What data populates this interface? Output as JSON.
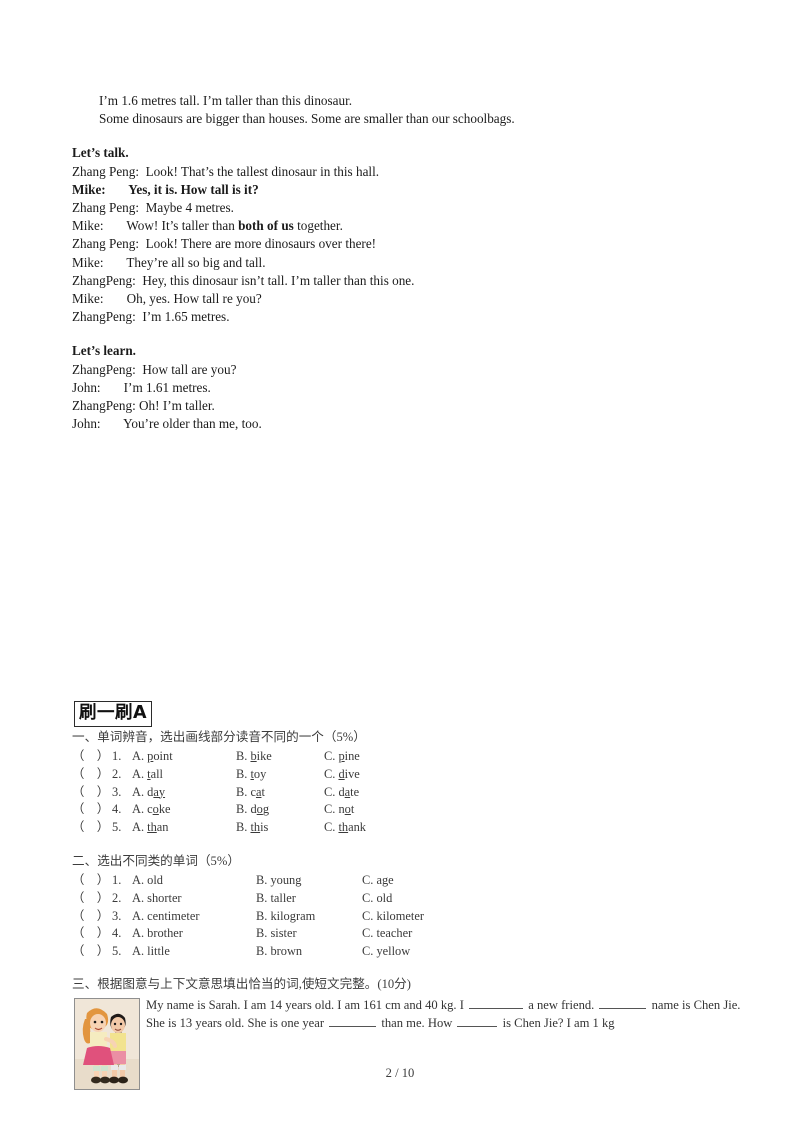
{
  "lesson": {
    "intro_lines": [
      "I’m 1.6 metres tall. I’m taller than this dinosaur.",
      "Some dinosaurs are bigger than houses. Some are smaller than our schoolbags."
    ],
    "talk_heading": "Let’s talk.",
    "talk_lines": [
      {
        "speaker": "Zhang Peng:",
        "text": "  Look! That’s the tallest dinosaur in this hall.",
        "bold": false
      },
      {
        "speaker": "Mike:",
        "text": "       Yes, it is. How tall is it?",
        "bold": true
      },
      {
        "speaker": "Zhang Peng:",
        "text": "  Maybe 4 metres.",
        "bold": false
      },
      {
        "speaker": "Mike:",
        "text": "       Wow! It’s taller than ",
        "bold_fragment": "both of us",
        "text_after": " together.",
        "bold": false
      },
      {
        "speaker": "Zhang Peng:",
        "text": "  Look! There are more dinosaurs over there!",
        "bold": false
      },
      {
        "speaker": "Mike:",
        "text": "       They’re all so big and tall.",
        "bold": false
      },
      {
        "speaker": "ZhangPeng:",
        "text": "  Hey, this dinosaur isn’t tall. I’m taller than this one.",
        "bold": false
      },
      {
        "speaker": "Mike:",
        "text": "       Oh, yes. How tall re you?",
        "bold": false
      },
      {
        "speaker": "ZhangPeng:",
        "text": "  I’m 1.65 metres.",
        "bold": false
      }
    ],
    "learn_heading": "Let’s learn.",
    "learn_lines": [
      {
        "speaker": "ZhangPeng:",
        "text": "  How tall are you?"
      },
      {
        "speaker": "John:",
        "text": "       I’m 1.61 metres."
      },
      {
        "speaker": "ZhangPeng:",
        "text": " Oh! I’m taller."
      },
      {
        "speaker": "John:",
        "text": "       You’re older than me, too."
      }
    ]
  },
  "brush_box": {
    "label": "刷一刷A"
  },
  "section_one": {
    "heading": "一、单词辨音，选出画线部分读音不同的一个（5%）",
    "items": [
      {
        "num": "1.",
        "a_pre": "",
        "a_ul": "p",
        "a_post": "oint",
        "b_pre": "",
        "b_ul": "b",
        "b_post": "ike",
        "c_pre": "",
        "c_ul": "p",
        "c_post": "ine"
      },
      {
        "num": "2.",
        "a_pre": "",
        "a_ul": "t",
        "a_post": "all",
        "b_pre": "",
        "b_ul": "t",
        "b_post": "oy",
        "c_pre": "",
        "c_ul": "d",
        "c_post": "ive"
      },
      {
        "num": "3.",
        "a_pre": "d",
        "a_ul": "ay",
        "a_post": "",
        "b_pre": "c",
        "b_ul": "a",
        "b_post": "t",
        "c_pre": "d",
        "c_ul": "a",
        "c_post": "te"
      },
      {
        "num": "4.",
        "a_pre": "c",
        "a_ul": "o",
        "a_post": "ke",
        "b_pre": "d",
        "b_ul": "o",
        "b_post": "g",
        "c_pre": "n",
        "c_ul": "o",
        "c_post": "t"
      },
      {
        "num": "5.",
        "a_pre": "",
        "a_ul": "th",
        "a_post": "an",
        "b_pre": "",
        "b_ul": "th",
        "b_post": "is",
        "c_pre": "",
        "c_ul": "th",
        "c_post": "ank"
      }
    ]
  },
  "section_two": {
    "heading": "二、选出不同类的单词（5%）",
    "items": [
      {
        "num": "1.",
        "a": "old",
        "b": "young",
        "c": "age"
      },
      {
        "num": "2.",
        "a": "shorter",
        "b": "taller",
        "c": "old"
      },
      {
        "num": "3.",
        "a": "centimeter",
        "b": "kilogram",
        "c": "kilometer"
      },
      {
        "num": "4.",
        "a": "brother",
        "b": "sister",
        "c": "teacher"
      },
      {
        "num": "5.",
        "a": "little",
        "b": "brown",
        "c": "yellow"
      }
    ]
  },
  "section_three": {
    "heading": "三、根据图意与上下文意思填出恰当的词,使短文完整。(10分)",
    "image_alt": "two-children-illustration",
    "paragraph_part1": "My name is Sarah. I am 14 years old. I am 161 cm and 40 kg. I ",
    "paragraph_part2": " a new friend. ",
    "paragraph_part3": " name is Chen Jie. She is 13 years old. She is one year ",
    "paragraph_part4": " than me. How ",
    "paragraph_part5": " is Chen Jie? I am 1 kg"
  },
  "footer": {
    "page_indicator": "2 / 10"
  },
  "colors": {
    "text": "#1b1b1b",
    "scan_text": "#3a3a3a",
    "rule": "#555555"
  }
}
